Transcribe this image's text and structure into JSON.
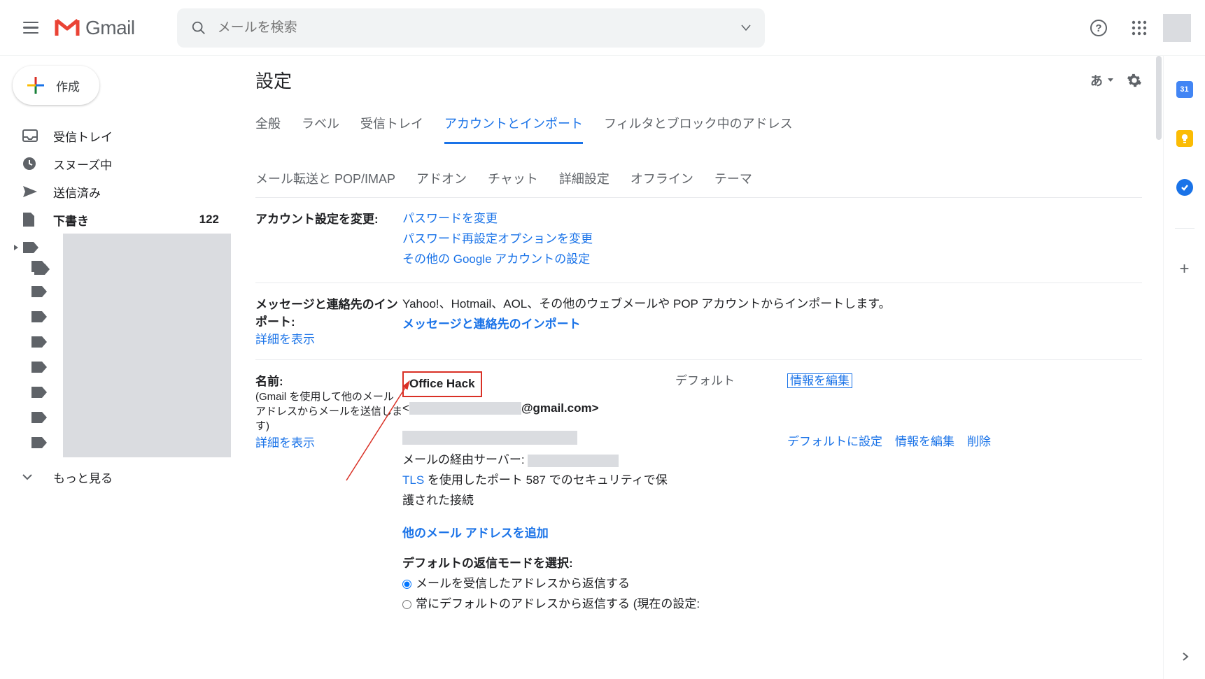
{
  "header": {
    "product": "Gmail",
    "search_placeholder": "メールを検索"
  },
  "sidebar": {
    "compose": "作成",
    "items": [
      {
        "label": "受信トレイ"
      },
      {
        "label": "スヌーズ中"
      },
      {
        "label": "送信済み"
      },
      {
        "label": "下書き",
        "count": "122",
        "bold": true
      }
    ],
    "show_more": "もっと見る"
  },
  "settings": {
    "title": "設定",
    "lang_toggle": "あ",
    "tabs_row1": [
      "全般",
      "ラベル",
      "受信トレイ",
      "アカウントとインポート",
      "フィルタとブロック中のアドレス"
    ],
    "active_tab": "アカウントとインポート",
    "tabs_row2": [
      "メール転送と POP/IMAP",
      "アドオン",
      "チャット",
      "詳細設定",
      "オフライン",
      "テーマ"
    ]
  },
  "account_change": {
    "heading": "アカウント設定を変更:",
    "links": [
      "パスワードを変更",
      "パスワード再設定オプションを変更",
      "その他の Google アカウントの設定"
    ]
  },
  "import_sec": {
    "heading": "メッセージと連絡先のインポート:",
    "learn_more": "詳細を表示",
    "desc": "Yahoo!、Hotmail、AOL、その他のウェブメールや POP アカウントからインポートします。",
    "action": "メッセージと連絡先のインポート"
  },
  "name_sec": {
    "heading": "名前:",
    "sub": "(Gmail を使用して他のメール アドレスからメールを送信します)",
    "learn_more": "詳細を表示",
    "primary_name": "Office Hack",
    "email_prefix": "<",
    "email_suffix": "@gmail.com>",
    "default_label": "デフォルト",
    "edit_info": "情報を編集",
    "mail_server_label": "メールの経由サーバー:",
    "tls_desc_1": "TLS",
    "tls_desc_2": " を使用したポート 587 でのセキュリティで保護された接続",
    "set_default": "デフォルトに設定",
    "edit_info2": "情報を編集",
    "delete": "削除",
    "add_address": "他のメール アドレスを追加",
    "default_mode_label": "デフォルトの返信モードを選択:",
    "radio1": "メールを受信したアドレスから返信する",
    "radio2": "常にデフォルトのアドレスから返信する (現在の設定:"
  },
  "rightbar": {
    "calendar_day": "31"
  }
}
